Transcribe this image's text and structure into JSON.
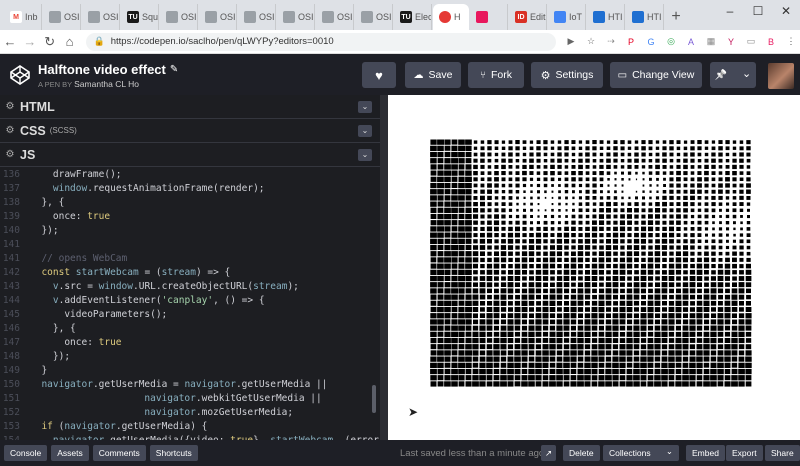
{
  "browser": {
    "tabs": [
      {
        "label": "Inb",
        "fav_color": "#ea4335",
        "fav_text": "M",
        "fav_text_color": "#ea4335",
        "fav_bg": "#fff"
      },
      {
        "label": "OSI",
        "fav_color": "#9aa0a6"
      },
      {
        "label": "OSI",
        "fav_color": "#9aa0a6"
      },
      {
        "label": "Squ",
        "fav_color": "#1a1a1a",
        "fav_text": "TU",
        "fav_text_color": "#fff"
      },
      {
        "label": "OSI",
        "fav_color": "#9aa0a6"
      },
      {
        "label": "OSI",
        "fav_color": "#9aa0a6"
      },
      {
        "label": "OSI",
        "fav_color": "#9aa0a6"
      },
      {
        "label": "OSI",
        "fav_color": "#9aa0a6"
      },
      {
        "label": "OSI",
        "fav_color": "#9aa0a6"
      },
      {
        "label": "OSI",
        "fav_color": "#9aa0a6"
      },
      {
        "label": "Elec",
        "fav_color": "#1a1a1a",
        "fav_text": "TU",
        "fav_text_color": "#fff"
      },
      {
        "label": "H",
        "fav_color": "#ffffff",
        "active": true
      },
      {
        "label": "",
        "fav_color": "#e8175d"
      },
      {
        "label": "Edit",
        "fav_color": "#d93025",
        "fav_text": "ID",
        "fav_text_color": "#fff"
      },
      {
        "label": "IoT",
        "fav_color": "#4285f4"
      },
      {
        "label": "HTI",
        "fav_color": "#1f6fd1"
      },
      {
        "label": "HTI",
        "fav_color": "#1f6fd1"
      }
    ],
    "new_tab": "+",
    "url": "https://codepen.io/saclho/pen/qLWYPy?editors=0010",
    "window_min": "–",
    "window_max": "☐",
    "window_close": "✕",
    "extensions": [
      {
        "name": "camera-icon",
        "glyph": "▶",
        "color": "#666"
      },
      {
        "name": "star-icon",
        "glyph": "☆",
        "color": "#666"
      },
      {
        "name": "ext-icon-1",
        "glyph": "⇢",
        "color": "#888"
      },
      {
        "name": "pinterest-icon",
        "glyph": "P",
        "color": "#e60023"
      },
      {
        "name": "translate-icon",
        "glyph": "G",
        "color": "#4285f4"
      },
      {
        "name": "ext-icon-2",
        "glyph": "◎",
        "color": "#34a853"
      },
      {
        "name": "ext-icon-3",
        "glyph": "A",
        "color": "#7b5cd6"
      },
      {
        "name": "ext-icon-4",
        "glyph": "▦",
        "color": "#888"
      },
      {
        "name": "ext-icon-5",
        "glyph": "Y",
        "color": "#c2185b"
      },
      {
        "name": "ext-icon-6",
        "glyph": "▭",
        "color": "#888"
      },
      {
        "name": "profile-icon",
        "glyph": "B",
        "color": "#e91e63"
      },
      {
        "name": "menu-icon",
        "glyph": "⋮",
        "color": "#555"
      }
    ]
  },
  "header": {
    "title": "Halftone video effect",
    "edit_glyph": "✎",
    "by_prefix": "A PEN BY",
    "author": "Samantha CL Ho",
    "heart_glyph": "♥",
    "save_label": "Save",
    "fork_label": "Fork",
    "settings_label": "Settings",
    "change_view_label": "Change View",
    "pin_glyph": "📌",
    "dropdown_glyph": "⌄"
  },
  "editor": {
    "panels": [
      {
        "name": "HTML",
        "sub": ""
      },
      {
        "name": "CSS",
        "sub": "(SCSS)"
      },
      {
        "name": "JS",
        "sub": ""
      }
    ],
    "lines": [
      {
        "n": "136",
        "t": "    drawFrame();"
      },
      {
        "n": "137",
        "t": "    window.requestAnimationFrame(render);"
      },
      {
        "n": "138",
        "t": "  }, {"
      },
      {
        "n": "139",
        "t": "    once: true"
      },
      {
        "n": "140",
        "t": "  });"
      },
      {
        "n": "141",
        "t": ""
      },
      {
        "n": "141",
        "t": "  // opens WebCam"
      },
      {
        "n": "142",
        "t": "  const startWebcam = (stream) => {"
      },
      {
        "n": "143",
        "t": "    v.src = window.URL.createObjectURL(stream);"
      },
      {
        "n": "144",
        "t": "    v.addEventListener('canplay', () => {"
      },
      {
        "n": "145",
        "t": "      videoParameters();"
      },
      {
        "n": "146",
        "t": "    }, {"
      },
      {
        "n": "147",
        "t": "      once: true"
      },
      {
        "n": "148",
        "t": "    });"
      },
      {
        "n": "149",
        "t": "  }"
      },
      {
        "n": "150",
        "t": "  navigator.getUserMedia = navigator.getUserMedia ||"
      },
      {
        "n": "151",
        "t": "                    navigator.webkitGetUserMedia ||"
      },
      {
        "n": "152",
        "t": "                    navigator.mozGetUserMedia;"
      },
      {
        "n": "153",
        "t": "  if (navigator.getUserMedia) {"
      },
      {
        "n": "154",
        "t": "    navigator.getUserMedia({video: true}, startWebcam, (error)"
      }
    ]
  },
  "footer": {
    "console_label": "Console",
    "assets_label": "Assets",
    "comments_label": "Comments",
    "shortcuts_label": "Shortcuts",
    "saved_text": "Last saved less than a minute ago",
    "open_glyph": "↗",
    "delete_label": "Delete",
    "collections_label": "Collections",
    "collections_chevron": "⌄",
    "embed_label": "Embed",
    "export_label": "Export",
    "share_label": "Share"
  },
  "colors": {
    "keyword": "#ddca7e",
    "variable": "#88afbf",
    "string": "#a6d4ad",
    "comment": "#5d6070",
    "func": "#d5dbe2",
    "number": "#4b4e59"
  }
}
